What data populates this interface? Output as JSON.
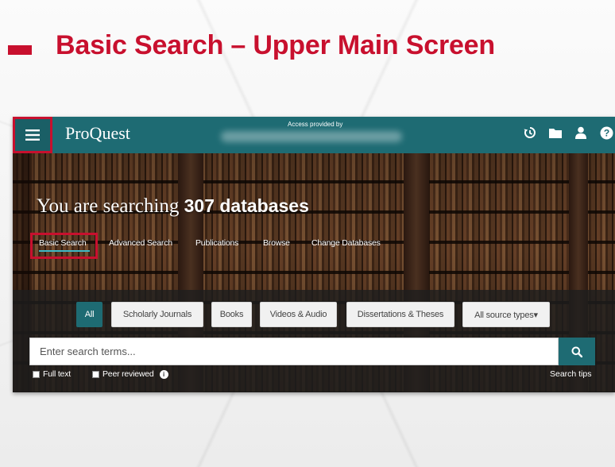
{
  "slide": {
    "title": "Basic Search – Upper Main Screen",
    "accent_color": "#c8102e"
  },
  "header": {
    "menu_icon": "hamburger-menu-icon",
    "brand": "ProQuest",
    "access_label": "Access provided by",
    "icons": [
      "history-icon",
      "folder-icon",
      "user-icon",
      "help-icon"
    ],
    "bar_color": "#1e6b73"
  },
  "hero": {
    "headline_prefix": "You are searching ",
    "headline_count": "307 databases",
    "tabs": [
      {
        "label": "Basic Search",
        "active": true
      },
      {
        "label": "Advanced Search",
        "active": false
      },
      {
        "label": "Publications",
        "active": false
      },
      {
        "label": "Browse",
        "active": false
      },
      {
        "label": "Change Databases",
        "active": false
      }
    ]
  },
  "search": {
    "source_types": [
      {
        "label": "All",
        "active": true
      },
      {
        "label": "Scholarly Journals",
        "active": false
      },
      {
        "label": "Books",
        "active": false
      },
      {
        "label": "Videos & Audio",
        "active": false
      },
      {
        "label": "Dissertations & Theses",
        "active": false
      },
      {
        "label": "All source types▾",
        "active": false
      }
    ],
    "placeholder": "Enter search terms...",
    "value": "",
    "button_icon": "search-icon",
    "full_text_label": "Full text",
    "peer_reviewed_label": "Peer reviewed",
    "info_symbol": "i",
    "search_tips_label": "Search tips"
  }
}
